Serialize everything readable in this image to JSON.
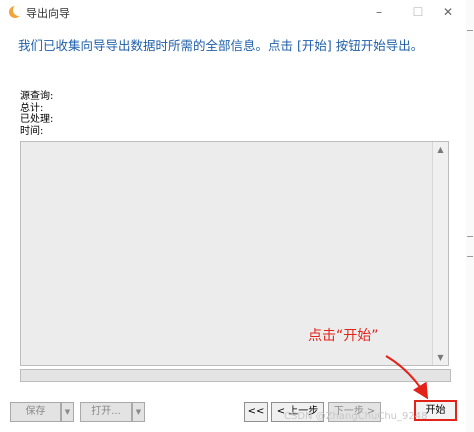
{
  "window": {
    "title": "导出向导",
    "minimize": "–",
    "maximize": "☐",
    "close": "✕"
  },
  "heading": "我们已收集向导导出数据时所需的全部信息。点击 [开始] 按钮开始导出。",
  "stats": [
    {
      "label": "源查询:"
    },
    {
      "label": "总计:"
    },
    {
      "label": "已处理:"
    },
    {
      "label": "时间:"
    }
  ],
  "scroll": {
    "up": "▲",
    "down": "▼"
  },
  "annotation": "点击“开始”",
  "footer": {
    "save": "保存",
    "open": "打开...",
    "first": "<<",
    "prev": "< 上一步",
    "next": "下一步 >",
    "start": "开始",
    "caret": "▼"
  },
  "watermark": "CSDN @ZhangChuChu_9248",
  "colors": {
    "accent": "#1f5fa8",
    "annotation": "#e2231a"
  }
}
